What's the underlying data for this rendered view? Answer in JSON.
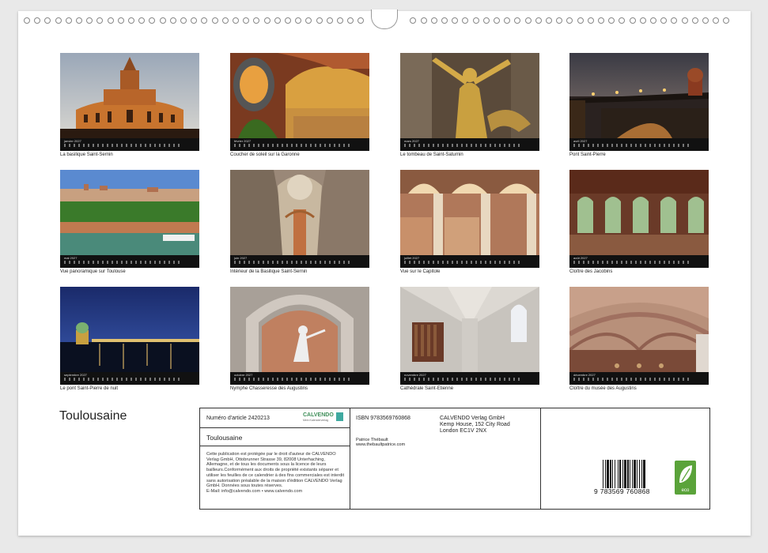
{
  "calendar": {
    "title": "Toulousaine",
    "year": "2027",
    "months": [
      {
        "month": "janvier",
        "caption": "La basilique Saint-Sernin"
      },
      {
        "month": "février",
        "caption": "Coucher de soleil sur la Garonne"
      },
      {
        "month": "mars",
        "caption": "Le tombeau de Saint-Saturnin"
      },
      {
        "month": "avril",
        "caption": "Pont Saint-Pierre"
      },
      {
        "month": "mai",
        "caption": "Vue panoramique sur Toulouse"
      },
      {
        "month": "juin",
        "caption": "Intérieur de la Basilique Saint-Sernin"
      },
      {
        "month": "juillet",
        "caption": "Vue sur le Capitole"
      },
      {
        "month": "août",
        "caption": "Cloître des Jacobins"
      },
      {
        "month": "septembre",
        "caption": "Le pont Saint-Pierre de nuit"
      },
      {
        "month": "octobre",
        "caption": "Nymphe Chasseresse des Augustins"
      },
      {
        "month": "novembre",
        "caption": "Cathédrale Saint-Etienne"
      },
      {
        "month": "décembre",
        "caption": "Cloître du musée des Augustins"
      }
    ]
  },
  "info": {
    "article_no": "Numéro d'article 2420213",
    "logo_text": "CALVENDO",
    "logo_sub": "Mein Kalenderverlag",
    "title": "Toulousaine",
    "legal": "Cette publication est protégée par le droit d'auteur de CALVENDO Verlag GmbH, Ottobrunner Strasse 39, 82008 Unterhaching,  Allemagne, et de tous les documents sous la licence de leurs bailleurs.Conformément aux droits de propriété existants séparer et utiliser les feuilles de ce calendrier à des fins commerciales est interdit sans autorisation préalable de la maison d'édition  CALVENDO Verlag GmbH. Données sous toutes réserves.",
    "email_line": "E-Mail: info@calvendo.com • www.calvendo.com",
    "isbn": "ISBN 9783569760868",
    "author": "Patrice Thébault",
    "author_site": "www.thebaultpatrice.com",
    "publisher_lines": [
      "CALVENDO Verlag GmbH",
      "Kemp House, 152 City Road",
      "London EC1V 2NX"
    ],
    "barcode_digits": "9 783569 760868",
    "eco_label": "eco"
  }
}
